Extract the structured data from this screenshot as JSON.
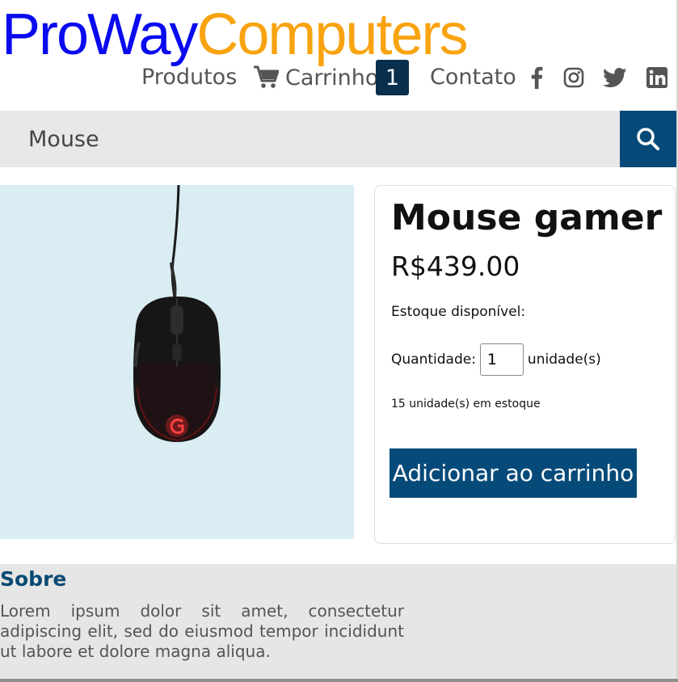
{
  "header": {
    "logo_part1": "ProWay",
    "logo_part2": "Computers",
    "logo_color1": "#0a0af0",
    "logo_color2": "#f8a30f"
  },
  "nav": {
    "products": "Produtos",
    "cart": "Carrinho",
    "cart_count": "1",
    "contact": "Contato",
    "social_icons": [
      "facebook-icon",
      "instagram-icon",
      "twitter-icon",
      "linkedin-icon"
    ]
  },
  "search": {
    "value": "Mouse",
    "button_icon": "search-icon"
  },
  "product": {
    "image_icon": "mouse-image",
    "title": "Mouse gamer",
    "price": "R$439.00",
    "stock_label": "Estoque disponível:",
    "quantity_label": "Quantidade:",
    "quantity_value": "1",
    "unit_label": "unidade(s)",
    "stock_count": "15 unidade(s) em estoque",
    "add_to_cart": "Adicionar ao carrinho"
  },
  "footer": {
    "title": "Sobre",
    "text": "Lorem ipsum dolor sit amet, consectetur adipiscing elit, sed do eiusmod tempor incididunt ut labore et dolore magna aliqua."
  },
  "colors": {
    "primary": "#064a7a",
    "badge": "#0a2f4d",
    "image_bg": "#d9edf3"
  }
}
